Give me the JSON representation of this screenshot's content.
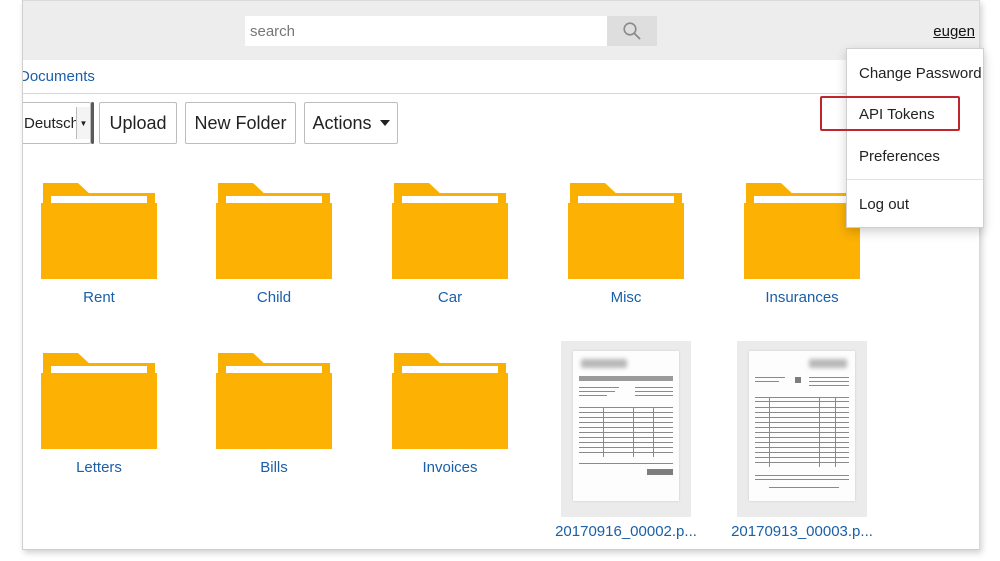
{
  "search": {
    "placeholder": "search"
  },
  "user": {
    "name": "eugen"
  },
  "breadcrumb": {
    "label": "Documents"
  },
  "toolbar": {
    "language": "Deutsch",
    "upload_label": "Upload",
    "new_folder_label": "New Folder",
    "actions_label": "Actions"
  },
  "folders": [
    {
      "label": "Rent"
    },
    {
      "label": "Child"
    },
    {
      "label": "Car"
    },
    {
      "label": "Misc"
    },
    {
      "label": "Insurances"
    },
    {
      "label": "Letters"
    },
    {
      "label": "Bills"
    },
    {
      "label": "Invoices"
    }
  ],
  "documents": [
    {
      "label": "20170916_00002.p..."
    },
    {
      "label": "20170913_00003.p..."
    }
  ],
  "user_menu": {
    "items": [
      {
        "label": "Change Password"
      },
      {
        "label": "API Tokens"
      },
      {
        "label": "Preferences"
      },
      {
        "label": "Log out"
      }
    ],
    "highlighted": "API Tokens"
  },
  "colors": {
    "folder": "#fcb103",
    "link": "#1a5fa8",
    "highlight": "#c0262d",
    "topbar": "#ededed"
  }
}
